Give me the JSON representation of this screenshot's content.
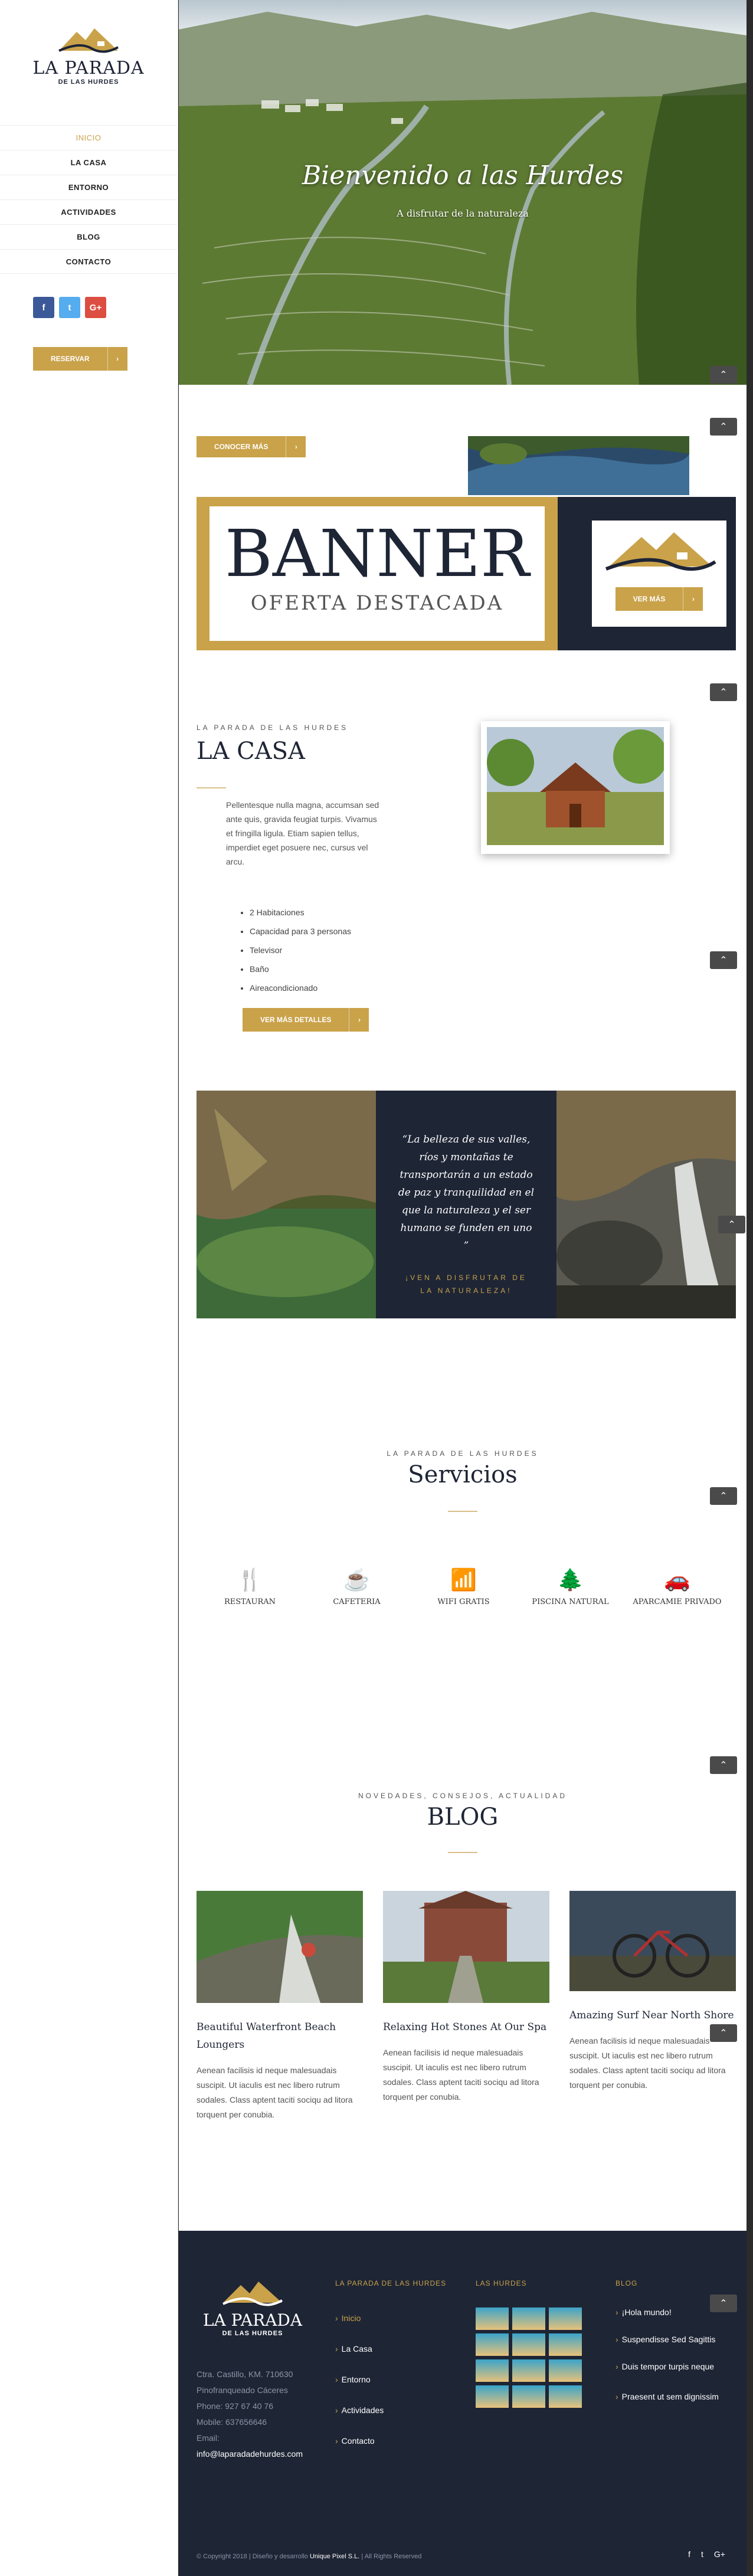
{
  "brand": {
    "name_line1": "LA PARADA",
    "name_line2": "DE LAS HURDES"
  },
  "nav": [
    {
      "label": "INICIO",
      "active": true
    },
    {
      "label": "LA CASA"
    },
    {
      "label": "ENTORNO"
    },
    {
      "label": "ACTIVIDADES"
    },
    {
      "label": "BLOG"
    },
    {
      "label": "CONTACTO"
    }
  ],
  "social": {
    "facebook": "f",
    "twitter": "t",
    "google": "G+"
  },
  "sidebar": {
    "reserve_label": "RESERVAR",
    "arrow": "›"
  },
  "hero": {
    "title": "Bienvenido a las Hurdes",
    "subtitle": "A disfrutar de la naturaleza"
  },
  "promo": {
    "button_label": "CONOCER MÁS",
    "arrow": "›"
  },
  "banner": {
    "title": "BANNER",
    "subtitle": "OFERTA DESTACADA",
    "button_label": "VER MÁS",
    "arrow": "›"
  },
  "casa": {
    "eyebrow": "LA PARADA DE LAS HURDES",
    "title": "LA CASA",
    "description": "Pellentesque nulla magna, accumsan sed ante quis, gravida feugiat turpis. Vivamus et fringilla ligula. Etiam sapien tellus, imperdiet eget posuere nec, cursus vel arcu.",
    "features": [
      "2 Habitaciones",
      "Capacidad para 3 personas",
      "Televisor",
      "Baño",
      "Aireacondicionado"
    ],
    "button_label": "VER MÁS DETALLES",
    "arrow": "›"
  },
  "quote": {
    "text": "“La belleza de sus valles, ríos y montañas te transportarán a un estado de paz y tranquilidad en el que la naturaleza y el ser humano se funden en uno ”",
    "cta": "¡VEN A DISFRUTAR DE LA NATURALEZA!"
  },
  "services": {
    "eyebrow": "LA PARADA DE LAS HURDES",
    "title": "Servicios",
    "items": [
      {
        "icon": "restaurant-icon",
        "glyph": "🍴",
        "label": "RESTAURAN"
      },
      {
        "icon": "coffee-icon",
        "glyph": "☕",
        "label": "CAFETERIA"
      },
      {
        "icon": "wifi-icon",
        "glyph": "📶",
        "label": "WIFI GRATIS"
      },
      {
        "icon": "tree-icon",
        "glyph": "🌲",
        "label": "PISCINA NATURAL"
      },
      {
        "icon": "car-icon",
        "glyph": "🚗",
        "label": "APARCAMIE PRIVADO"
      }
    ]
  },
  "blog": {
    "eyebrow": "NOVEDADES, CONSEJOS, ACTUALIDAD",
    "title": "BLOG",
    "posts": [
      {
        "title": "Beautiful Waterfront Beach Loungers",
        "excerpt": "Aenean facilisis id neque malesuadais suscipit. Ut iaculis est nec libero rutrum sodales. Class aptent taciti sociqu ad litora torquent per conubia."
      },
      {
        "title": "Relaxing Hot Stones At Our Spa",
        "excerpt": "Aenean facilisis id neque malesuadais suscipit. Ut iaculis est nec libero rutrum sodales. Class aptent taciti sociqu ad litora torquent per conubia."
      },
      {
        "title": "Amazing Surf Near North Shore",
        "excerpt": "Aenean facilisis id neque malesuadais suscipit. Ut iaculis est nec libero rutrum sodales. Class aptent taciti sociqu ad litora torquent per conubia."
      }
    ]
  },
  "footer": {
    "contact": [
      "Ctra. Castillo, KM. 710630",
      "Pinofranqueado Cáceres",
      "Phone: 927 67 40 76",
      "Mobile: 637656646",
      "Email:",
      "info@laparadadehurdes.com"
    ],
    "col1_title": "LA PARADA DE LAS HURDES",
    "col1_links": [
      "Inicio",
      "La Casa",
      "Entorno",
      "Actividades",
      "Contacto"
    ],
    "col2_title": "LAS HURDES",
    "col3_title": "BLOG",
    "col3_links": [
      "¡Hola mundo!",
      "Suspendisse Sed Sagittis",
      "Duis tempor turpis neque",
      "Praesent ut sem dignissim"
    ],
    "copyright": "© Copyright 2018  |  Diseño y desarrollo",
    "developer": "Unique Pixel S.L.",
    "rights": "|  All Rights Reserved",
    "social": {
      "facebook": "f",
      "twitter": "t",
      "google": "G+"
    }
  },
  "totop_glyph": "⌃",
  "colors": {
    "accent": "#c9a24a",
    "navy": "#1e2535"
  }
}
